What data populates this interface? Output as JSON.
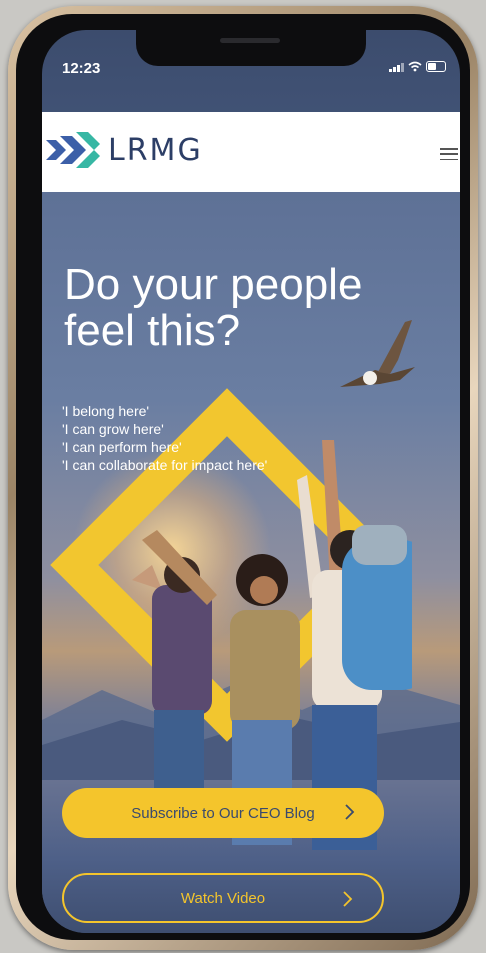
{
  "status_bar": {
    "time": "12:23"
  },
  "header": {
    "logo_text": "LRMG"
  },
  "hero": {
    "headline_line1": "Do your people",
    "headline_line2": "feel this?",
    "taglines": [
      "'I belong here'",
      "'I can grow here'",
      "'I can perform here'",
      "'I can collaborate for impact here'"
    ]
  },
  "cta": {
    "subscribe_label": "Subscribe to Our CEO Blog",
    "watch_label": "Watch Video"
  },
  "colors": {
    "accent_yellow": "#f4c52c",
    "brand_navy": "#2c3e66",
    "logo_teal": "#37b7a4",
    "logo_blue": "#3c5fa8"
  }
}
